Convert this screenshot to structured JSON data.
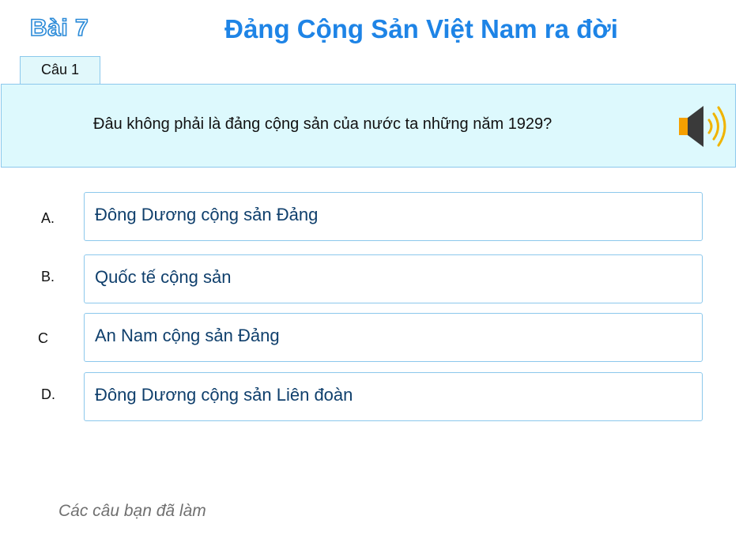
{
  "header": {
    "lesson": "Bài 7",
    "title": "Đảng Cộng Sản Việt Nam ra đời"
  },
  "question": {
    "tab_label": "Câu 1",
    "text": "Đâu không phải là đảng cộng sản của nước ta những năm 1929?",
    "audio_icon": "speaker-icon"
  },
  "answers": [
    {
      "letter": "A.",
      "text": "Đông Dương cộng sản Đảng"
    },
    {
      "letter": "B.",
      "text": "Quốc tế cộng sản"
    },
    {
      "letter": "C",
      "text": "An Nam cộng sản Đảng"
    },
    {
      "letter": "D.",
      "text": "Đông Dương cộng sản Liên đoàn"
    }
  ],
  "footer": {
    "done_label": "Các câu bạn đã làm"
  },
  "colors": {
    "title": "#1e84e6",
    "panel_bg": "#ddf9fd",
    "border": "#8cc8ec",
    "answer_text": "#0f3f6c",
    "speaker_body": "#f5a000",
    "speaker_cone": "#3a3a3a",
    "speaker_waves": "#f0b400"
  }
}
